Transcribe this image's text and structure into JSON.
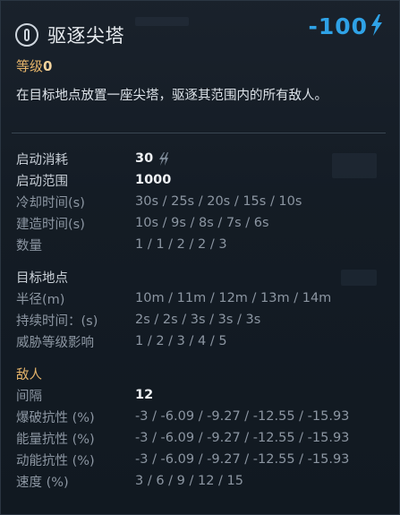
{
  "title": "驱逐尖塔",
  "cost": "-100",
  "level_label": "等级",
  "level_value": "0",
  "description": "在目标地点放置一座尖塔，驱逐其范围内的所有敌人。",
  "colors": {
    "accent_blue": "#2fa2e6",
    "accent_orange": "#e5b46a"
  },
  "icons": {
    "ability": "expel-spire-icon",
    "energy": "lightning-bolt-icon"
  },
  "stats": {
    "activation_cost_label": "启动消耗",
    "activation_cost_value": "30",
    "activation_range_label": "启动范围",
    "activation_range_value": "1000",
    "cooldown_label": "冷却时间(s)",
    "cooldown_value": "30s / 25s / 20s / 15s / 10s",
    "build_time_label": "建造时间(s)",
    "build_time_value": "10s / 9s / 8s / 7s / 6s",
    "count_label": "数量",
    "count_value": "1 / 1 / 2 / 2 / 3"
  },
  "target": {
    "section_label": "目标地点",
    "radius_label": "半径(m)",
    "radius_value": "10m / 11m / 12m / 13m / 14m",
    "duration_label": "持续时间：(s)",
    "duration_value": "2s / 2s / 3s / 3s / 3s",
    "threat_label": "威胁等级影响",
    "threat_value": "1 / 2 / 3 / 4 / 5"
  },
  "enemy": {
    "section_label": "敌人",
    "interval_label": "间隔",
    "interval_value": "12",
    "explosive_label": "爆破抗性 (%)",
    "explosive_value": "-3 / -6.09 / -9.27 / -12.55 / -15.93",
    "energy_label": "能量抗性 (%)",
    "energy_value": "-3 / -6.09 / -9.27 / -12.55 / -15.93",
    "kinetic_label": "动能抗性 (%)",
    "kinetic_value": "-3 / -6.09 / -9.27 / -12.55 / -15.93",
    "speed_label": "速度 (%)",
    "speed_value": "3 / 6 / 9 / 12 / 15"
  }
}
